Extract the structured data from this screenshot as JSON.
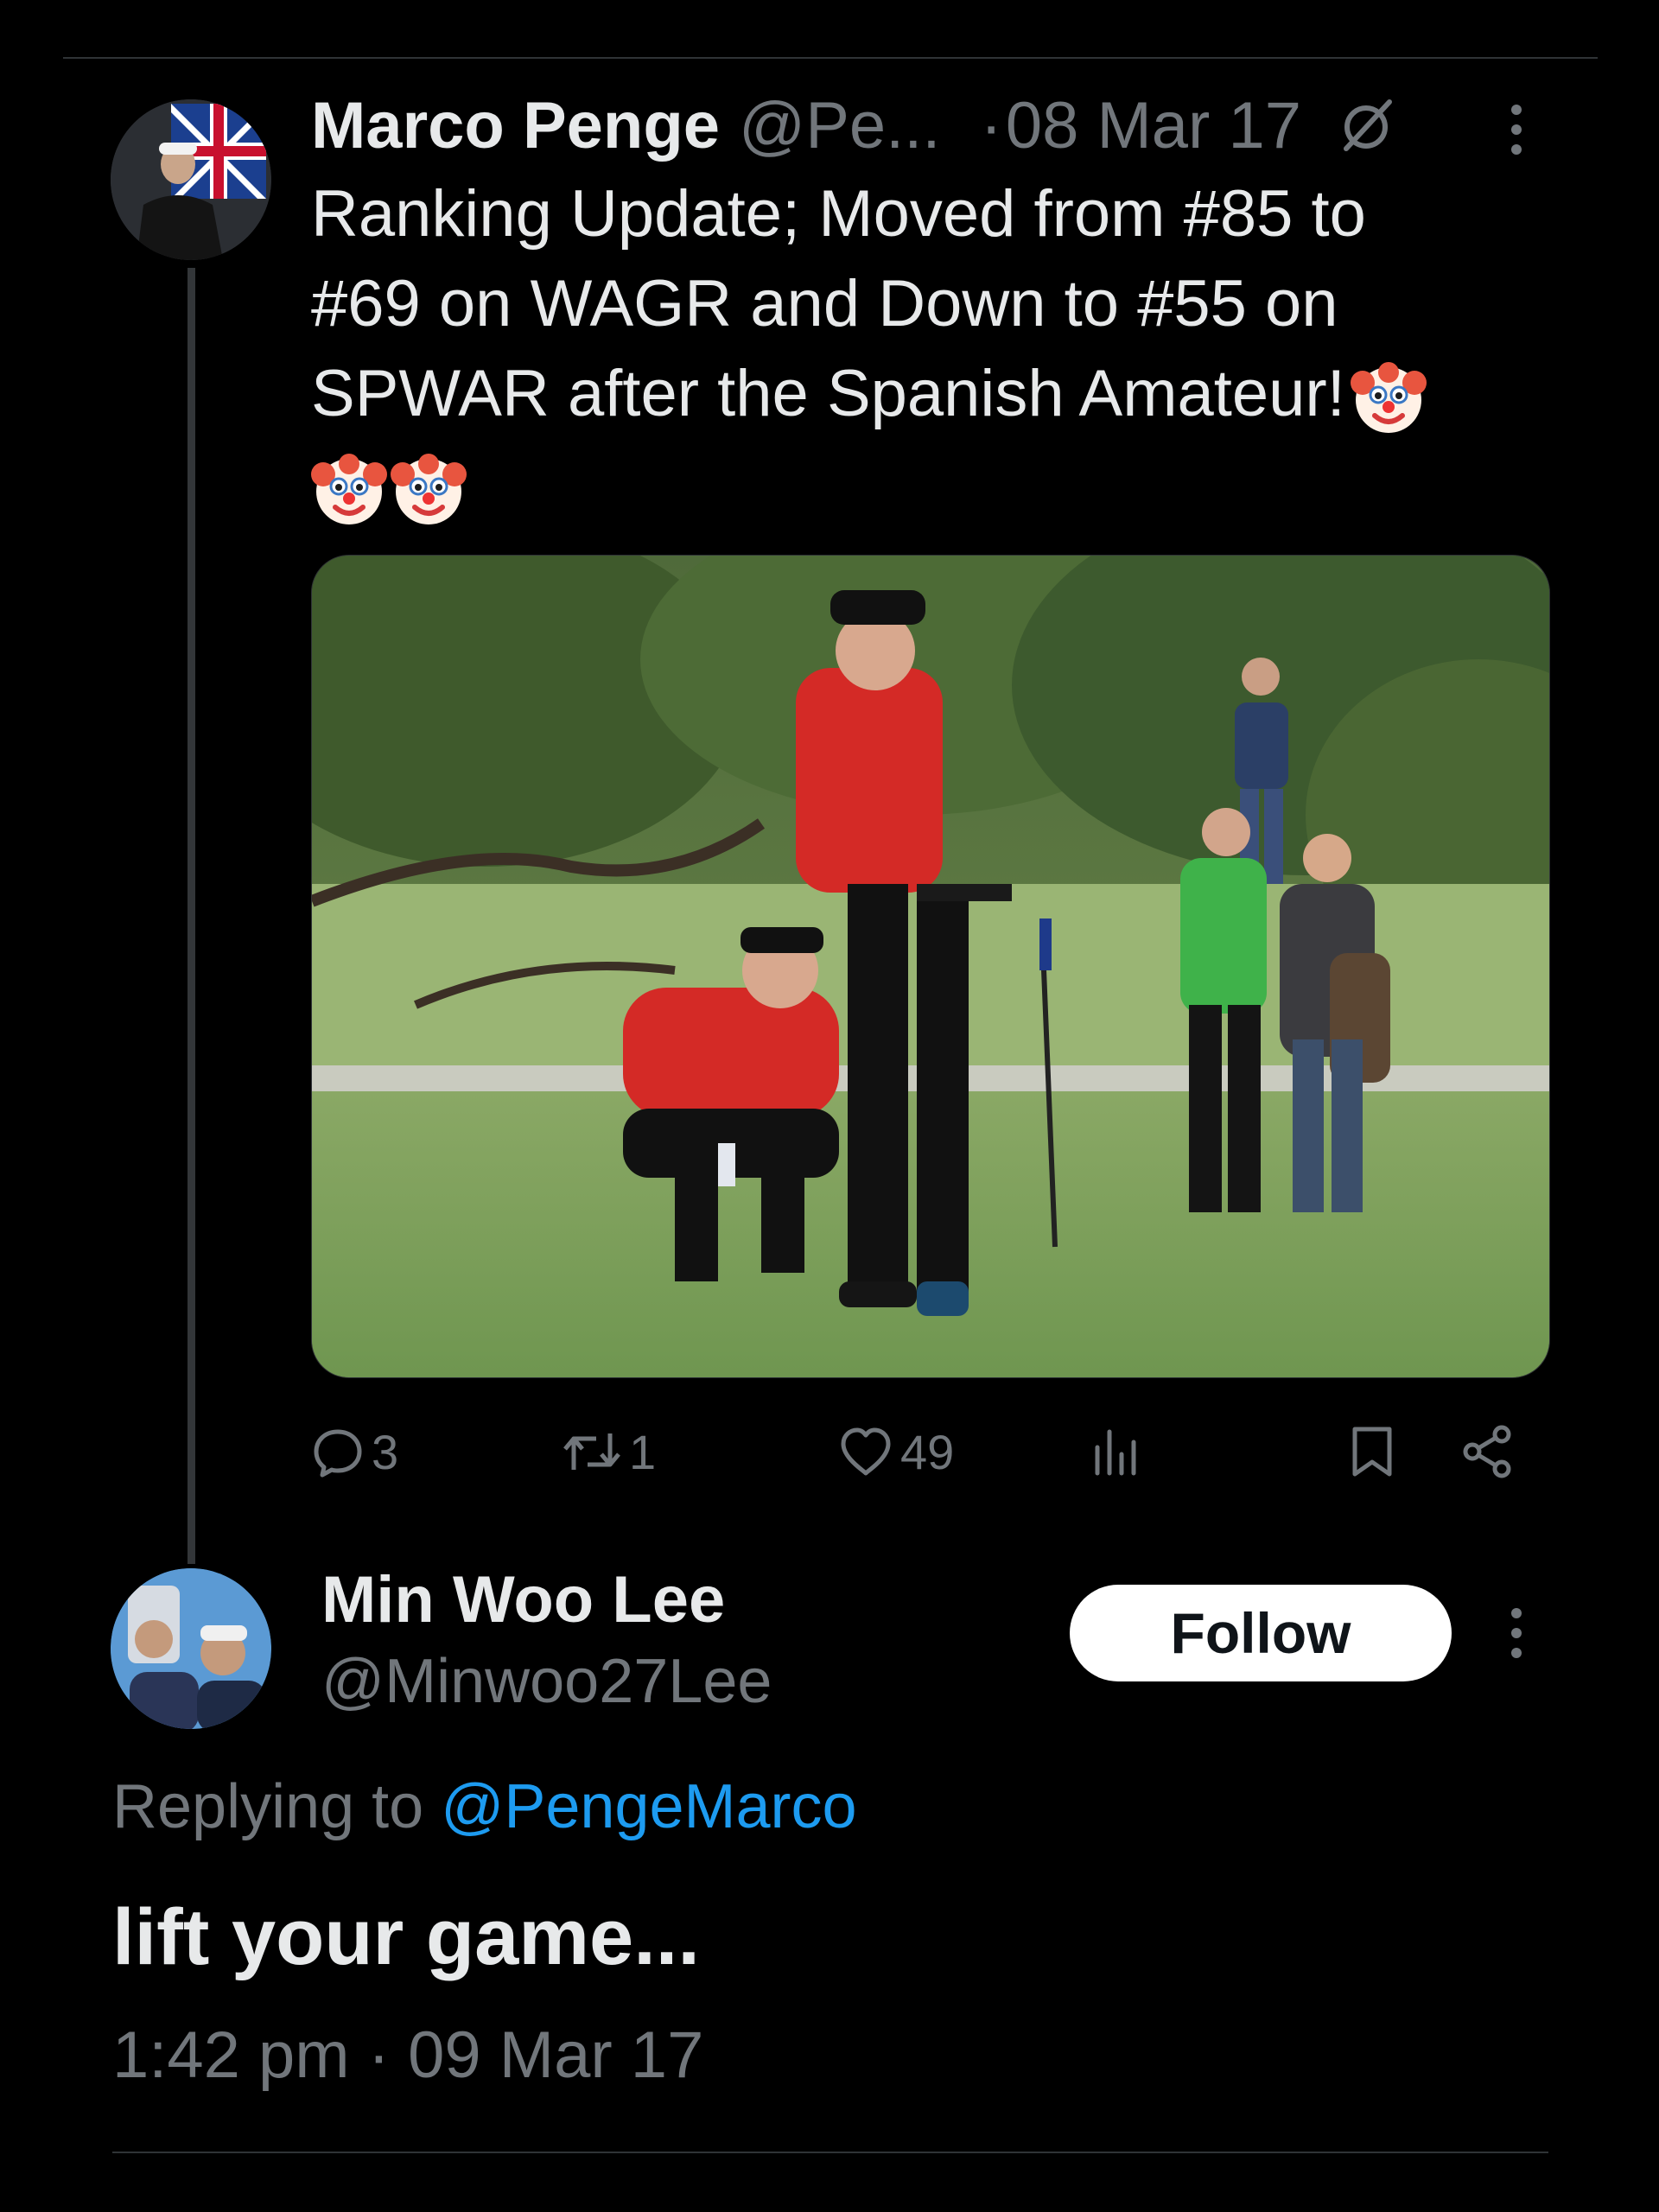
{
  "original_post": {
    "author_name": "Marco Penge",
    "author_handle": "@Pe...",
    "date": "08 Mar 17",
    "date_separator": "·",
    "text_lines": [
      "Ranking Update; Moved from #85 to",
      "#69 on WAGR and Down to #55 on",
      "SPWAR after the Spanish Amateur!"
    ],
    "emoji": "clown-face",
    "emoji_count": 3,
    "metrics": {
      "replies": "3",
      "reposts": "1",
      "likes": "49"
    },
    "icons": [
      "reply-icon",
      "repost-icon",
      "like-icon",
      "views-icon",
      "bookmark-icon",
      "share-icon",
      "edited-icon",
      "more-icon"
    ]
  },
  "reply_post": {
    "author_name": "Min Woo Lee",
    "author_handle": "@Minwoo27Lee",
    "follow_label": "Follow",
    "replying_prefix": "Replying to",
    "replying_to": "@PengeMarco",
    "text": "lift your game...",
    "timestamp": "1:42 pm · 09 Mar 17"
  },
  "colors": {
    "background": "#000000",
    "primary_text": "#e7e9ea",
    "secondary_text": "#71767b",
    "link": "#1d9bf0",
    "divider": "#2f3336",
    "follow_bg": "#ffffff"
  }
}
